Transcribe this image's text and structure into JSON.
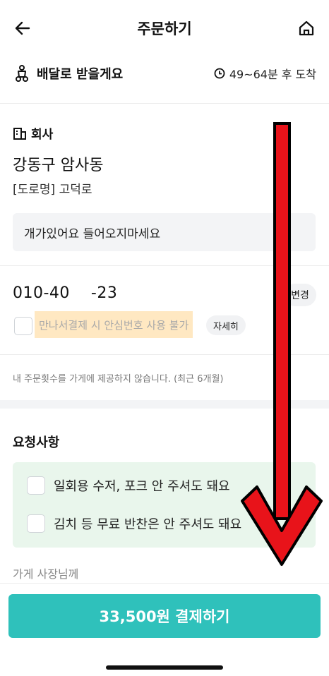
{
  "header": {
    "title": "주문하기",
    "back_icon": "back-arrow-icon",
    "home_icon": "home-icon"
  },
  "delivery": {
    "mode_label": "배달로 받을게요",
    "eta_label": "49~64분 후 도착",
    "mode_icon": "scooter-icon",
    "eta_icon": "clock-icon"
  },
  "address": {
    "label": "회사",
    "label_icon": "building-icon",
    "main": "강동구 암사동",
    "sub": "[도로명] 고덕로",
    "memo": "개가있어요 들어오지마세요"
  },
  "phone": {
    "number": "010-40    -23",
    "change_label": "변경",
    "safe_number_text": "만나서결제 시 안심번호 사용 불가",
    "detail_label": "자세히"
  },
  "order_count_note": "내 주문횟수를 가게에 제공하지 않습니다. (최근 6개월)",
  "requests": {
    "title": "요청사항",
    "options": [
      {
        "label": "일회용 수저, 포크 안 주셔도 돼요",
        "checked": false
      },
      {
        "label": "김치 등 무료 반찬은 안 주셔도 돼요",
        "checked": false
      }
    ],
    "owner_label": "가게 사장님께"
  },
  "payment": {
    "button_label": "33,500원 결제하기"
  },
  "colors": {
    "accent": "#2fc1bb",
    "highlight": "#ffe8c2",
    "request_bg": "#e9f6ec",
    "overlay_arrow": "#e8131a"
  }
}
